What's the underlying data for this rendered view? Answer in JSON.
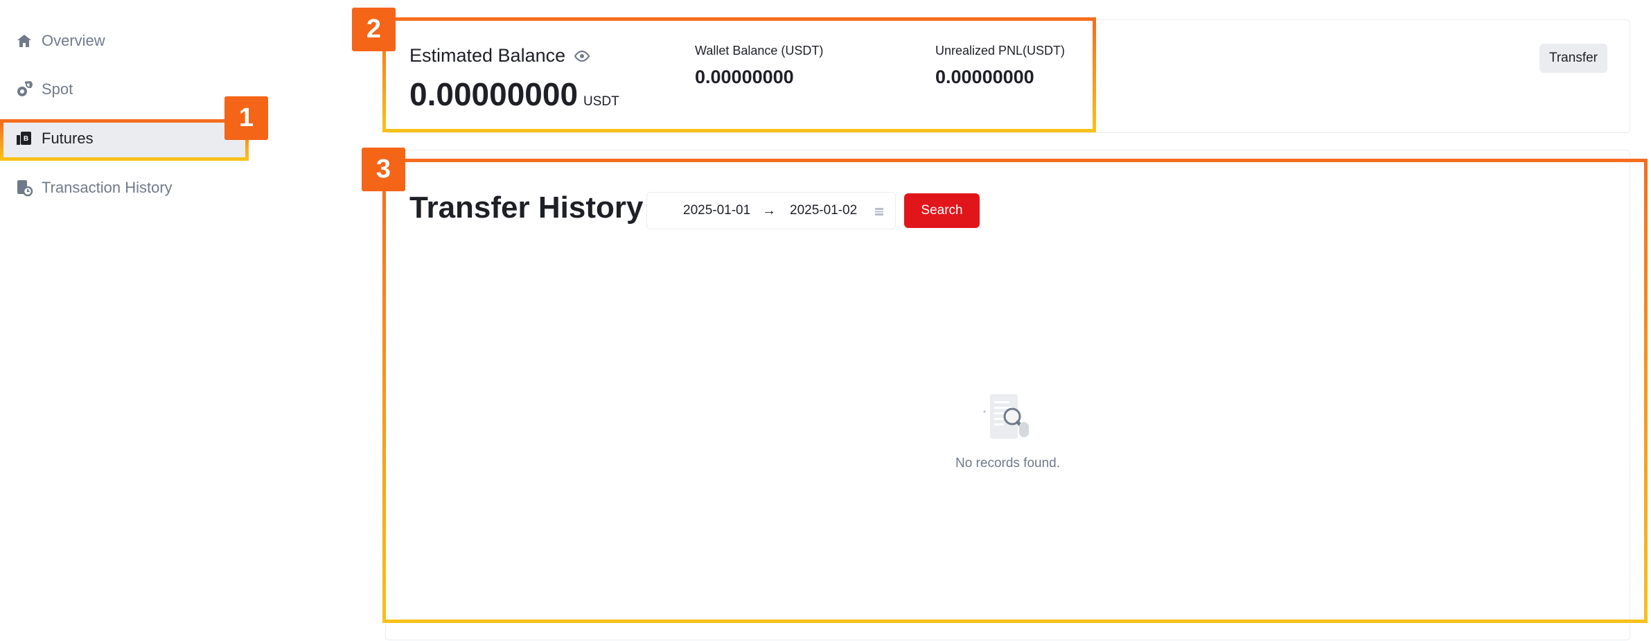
{
  "sidebar": {
    "items": [
      {
        "label": "Overview",
        "icon": "home-icon",
        "active": false
      },
      {
        "label": "Spot",
        "icon": "spot-icon",
        "active": false
      },
      {
        "label": "Futures",
        "icon": "futures-icon",
        "active": true
      },
      {
        "label": "Transaction History",
        "icon": "history-icon",
        "active": false
      }
    ]
  },
  "balance": {
    "estimated_label": "Estimated Balance",
    "estimated_value": "0.00000000",
    "estimated_unit": "USDT",
    "wallet_label": "Wallet Balance (USDT)",
    "wallet_value": "0.00000000",
    "pnl_label": "Unrealized PNL(USDT)",
    "pnl_value": "0.00000000",
    "transfer_label": "Transfer"
  },
  "history": {
    "title": "Transfer History",
    "date_start": "2025-01-01",
    "date_arrow": "→",
    "date_end": "2025-01-02",
    "search_label": "Search",
    "empty_text": "No records found."
  },
  "annotations": {
    "badge_1": "1",
    "badge_2": "2",
    "badge_3": "3"
  },
  "colors": {
    "accent": "#e0161b",
    "annotation_orange": "#f46518",
    "annotation_yellow": "#f8c01a",
    "active_bg": "#eaecef",
    "muted_text": "#707a8a"
  }
}
